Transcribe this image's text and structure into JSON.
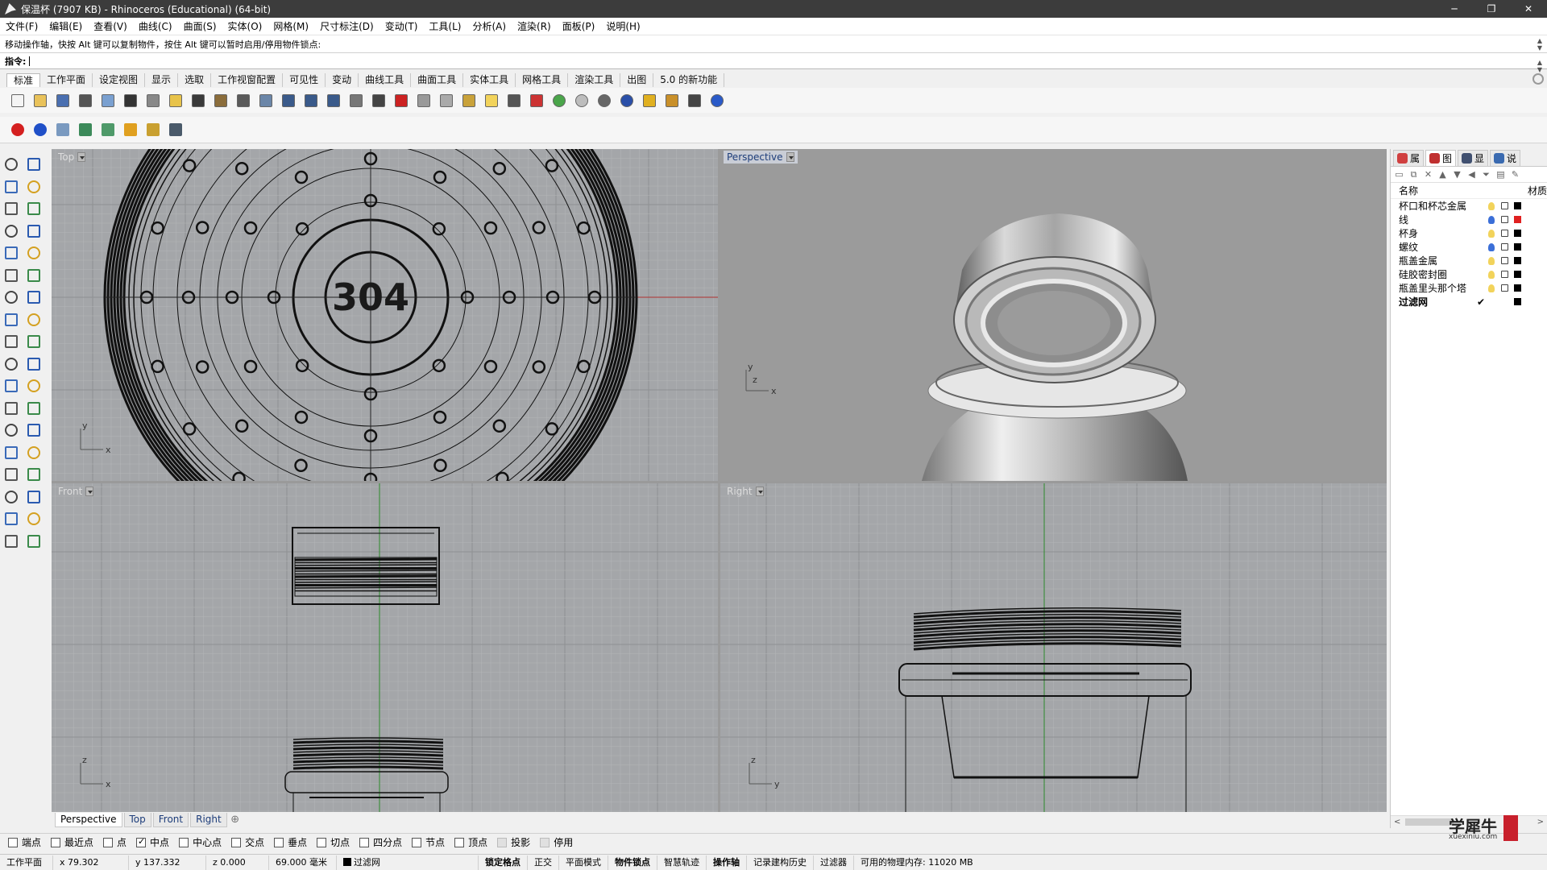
{
  "titlebar": {
    "title": "保温杯 (7907 KB) - Rhinoceros (Educational) (64-bit)",
    "minimize": "─",
    "restore": "❐",
    "close": "✕"
  },
  "menu": [
    "文件(F)",
    "编辑(E)",
    "查看(V)",
    "曲线(C)",
    "曲面(S)",
    "实体(O)",
    "网格(M)",
    "尺寸标注(D)",
    "变动(T)",
    "工具(L)",
    "分析(A)",
    "渲染(R)",
    "面板(P)",
    "说明(H)"
  ],
  "command": {
    "history": "移动操作轴，快按 Alt 键可以复制物件，按住 Alt 键可以暂时启用/停用物件锁点:",
    "prompt": "指令:"
  },
  "toolbar_tabs": [
    "标准",
    "工作平面",
    "设定视图",
    "显示",
    "选取",
    "工作视窗配置",
    "可见性",
    "变动",
    "曲线工具",
    "曲面工具",
    "实体工具",
    "网格工具",
    "渲染工具",
    "出图",
    "5.0 的新功能"
  ],
  "toolbar_row1": [
    "new-file-icon",
    "open-icon",
    "save-icon",
    "print-icon",
    "export-icon",
    "cut-icon",
    "copy-icon",
    "paste-icon",
    "undo-icon",
    "pan-hand-icon",
    "rotate-view-icon",
    "zoom-icon",
    "zoom-window-icon",
    "zoom-extents-icon",
    "zoom-selected-icon",
    "undo-view-icon",
    "four-viewports-icon",
    "car-icon",
    "hide-icon",
    "show-icon",
    "move-icon",
    "light-bulb-icon",
    "lock-icon",
    "shield-icon",
    "color-wheel-icon",
    "sphere-shaded-icon",
    "sphere-rendered-icon",
    "sphere-blue-icon",
    "pen-icon",
    "settings-gear-icon",
    "grid-snap-icon",
    "help-icon"
  ],
  "toolbar_row2": [
    "red-sphere-icon",
    "blue-sphere-icon",
    "box-render-icon",
    "gem-icon",
    "cup-icon",
    "cone-icon",
    "control-points-icon",
    "cylinder-icon"
  ],
  "colors": {
    "viewport_bg": "#a4a6a9",
    "perspective_bg": "#9b9b9b",
    "grid_minor": "#b3b5b8",
    "grid_major": "#8e9093",
    "axis_x": "#b03030",
    "axis_y": "#2b8a2b",
    "accent": "#1d3d7a"
  },
  "viewports": {
    "top": {
      "label": "Top",
      "model_text": "304",
      "axis_y": "y",
      "axis_x": "x"
    },
    "perspective": {
      "label": "Perspective",
      "axis_x": "x",
      "axis_y": "y",
      "axis_z": "z"
    },
    "front": {
      "label": "Front",
      "axis_y": "z",
      "axis_x": "x"
    },
    "right": {
      "label": "Right",
      "axis_y": "z",
      "axis_x": "y"
    }
  },
  "viewport_tabs": [
    "Perspective",
    "Top",
    "Front",
    "Right"
  ],
  "viewport_tabs_add": "⊕",
  "panel": {
    "tabs": [
      "属",
      "图",
      "显",
      "说"
    ],
    "header_name": "名称",
    "header_material": "材质",
    "layers": [
      {
        "name": "杯口和杯芯金属",
        "bulb": "#f2d35b",
        "color": "#000000",
        "current": false
      },
      {
        "name": "线",
        "bulb": "#3b6fd8",
        "color": "#e02020",
        "current": false
      },
      {
        "name": "杯身",
        "bulb": "#f2d35b",
        "color": "#000000",
        "current": false
      },
      {
        "name": "螺纹",
        "bulb": "#3b6fd8",
        "color": "#000000",
        "current": false
      },
      {
        "name": "瓶盖金属",
        "bulb": "#f2d35b",
        "color": "#000000",
        "current": false
      },
      {
        "name": "硅胶密封圈",
        "bulb": "#f2d35b",
        "color": "#000000",
        "current": false
      },
      {
        "name": "瓶盖里头那个塔",
        "bulb": "#f2d35b",
        "color": "#000000",
        "current": false
      },
      {
        "name": "过滤网",
        "bulb": "",
        "color": "#000000",
        "current": true,
        "check": "✔"
      }
    ],
    "scroll_left": "<",
    "scroll_right": ">"
  },
  "watermark": {
    "text": "学犀牛",
    "url": "xuexiniu.com"
  },
  "osnaps": [
    {
      "label": "端点",
      "checked": false,
      "disabled": false
    },
    {
      "label": "最近点",
      "checked": false,
      "disabled": false
    },
    {
      "label": "点",
      "checked": false,
      "disabled": false
    },
    {
      "label": "中点",
      "checked": true,
      "disabled": false
    },
    {
      "label": "中心点",
      "checked": false,
      "disabled": false
    },
    {
      "label": "交点",
      "checked": false,
      "disabled": false
    },
    {
      "label": "垂点",
      "checked": false,
      "disabled": false
    },
    {
      "label": "切点",
      "checked": false,
      "disabled": false
    },
    {
      "label": "四分点",
      "checked": false,
      "disabled": false
    },
    {
      "label": "节点",
      "checked": false,
      "disabled": false
    },
    {
      "label": "顶点",
      "checked": false,
      "disabled": false
    },
    {
      "label": "投影",
      "checked": false,
      "disabled": true
    },
    {
      "label": "停用",
      "checked": false,
      "disabled": true
    }
  ],
  "status": {
    "cplane": "工作平面",
    "x": "x 79.302",
    "y": "y 137.332",
    "z": "z 0.000",
    "units": "69.000 毫米",
    "layer": "过滤网",
    "grid_snap": "锁定格点",
    "ortho": "正交",
    "planar": "平面模式",
    "osnap": "物件锁点",
    "smarttrack": "智慧轨迹",
    "gumball": "操作轴",
    "history": "记录建构历史",
    "filter": "过滤器",
    "memory": "可用的物理内存: 11020 MB"
  }
}
